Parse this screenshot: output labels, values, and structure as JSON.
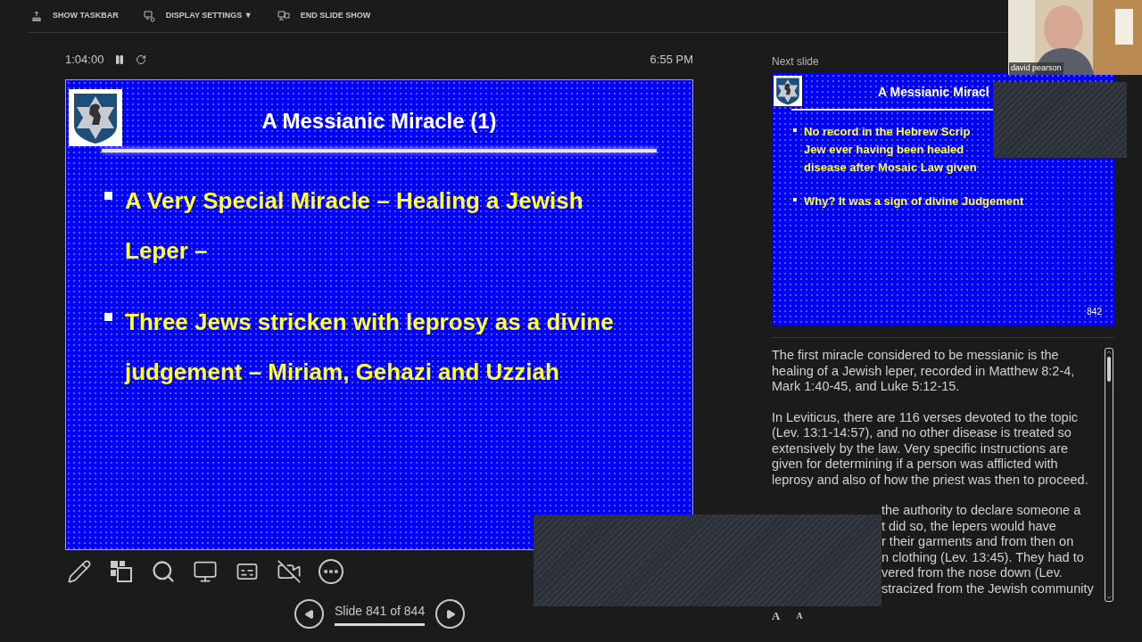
{
  "top_bar": [
    {
      "kind": "taskbar",
      "label": "SHOW TASKBAR"
    },
    {
      "kind": "display",
      "label": "DISPLAY SETTINGS",
      "caret": "▼"
    },
    {
      "kind": "end",
      "label": "END SLIDE SHOW"
    }
  ],
  "timer": {
    "elapsed": "1:04:00",
    "clock": "6:55 PM"
  },
  "current_slide": {
    "title": "A Messianic Miracle (1)",
    "bullets": [
      {
        "lines": [
          "A Very Special Miracle – Healing a Jewish",
          "Leper –"
        ]
      },
      {
        "lines": [
          "Three Jews stricken with leprosy as a divine",
          "judgement – Miriam, Gehazi and Uzziah"
        ]
      }
    ]
  },
  "tools": [
    {
      "kind": "pen"
    },
    {
      "kind": "slides"
    },
    {
      "kind": "zoom"
    },
    {
      "kind": "screen"
    },
    {
      "kind": "subtitles"
    },
    {
      "kind": "camera"
    },
    {
      "kind": "more"
    }
  ],
  "navigation": {
    "label": "Slide 841 of 844"
  },
  "next_slide": {
    "heading": "Next slide",
    "title": "A Messianic Miracl",
    "number": "842",
    "bullets": [
      {
        "lines": [
          "No record in the Hebrew Scrip",
          "Jew ever having been healed",
          "disease after Mosaic Law given"
        ]
      },
      {
        "lines": [
          "Why? It was a sign of divine Judgement"
        ]
      }
    ]
  },
  "webcam": {
    "name": "david pearson"
  },
  "notes": {
    "paragraphs": [
      "The first miracle considered to be messianic is the healing of a Jewish leper, recorded in Matthew 8:2-4, Mark 1:40-45, and Luke 5:12-15.",
      "In Leviticus, there are 116 verses devoted to the topic (Lev. 13:1-14:57), and no other disease is treated so extensively by the law. Very specific instructions are given for determining if a person was afflicted with leprosy and also of how the priest was then to proceed."
    ],
    "partial_lines": [
      "the authority to declare someone a",
      "t did so, the lepers would have",
      "r their garments and from then on",
      "n clothing (Lev. 13:45). They had to",
      "vered from the nose down (Lev.",
      "stracized from the Jewish community"
    ]
  },
  "font_buttons": [
    "A",
    "A"
  ]
}
